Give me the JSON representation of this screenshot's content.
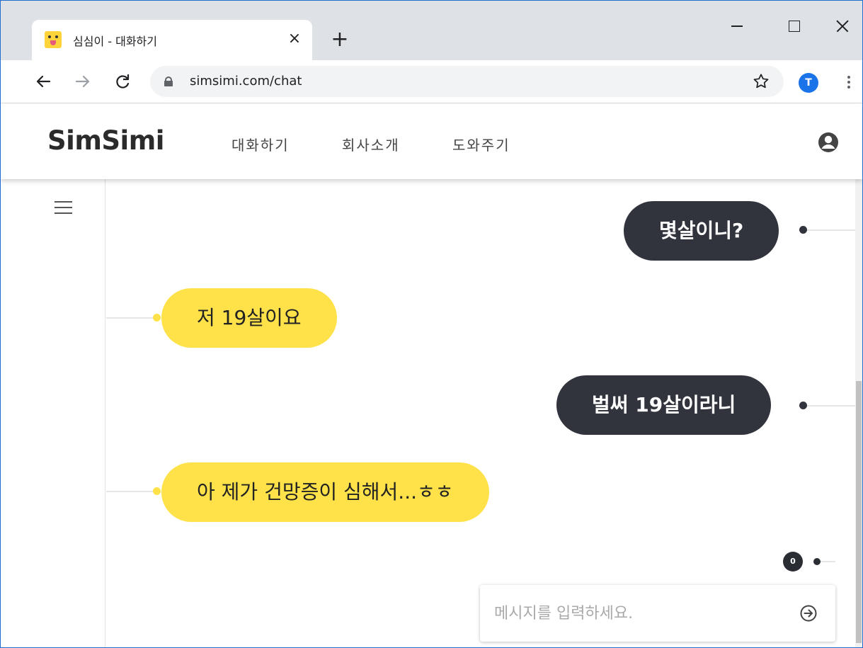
{
  "browser": {
    "tab_title": "심심이 - 대화하기",
    "tab_close": "×",
    "new_tab": "+",
    "url": "simsimi.com/chat",
    "profile_initial": "T",
    "frame_color": "#1e6fd0"
  },
  "header": {
    "logo": "SimSimi",
    "nav": [
      "대화하기",
      "회사소개",
      "도와주기"
    ]
  },
  "chat": {
    "messages": [
      {
        "sender": "user",
        "text": "몇살이니?"
      },
      {
        "sender": "bot",
        "text": "저 19살이요"
      },
      {
        "sender": "user",
        "text": "벌써 19살이라니"
      },
      {
        "sender": "bot",
        "text": "아 제가 건망증이 심해서...ㅎㅎ"
      }
    ],
    "counter": "0",
    "input_placeholder": "메시지를 입력하세요."
  },
  "colors": {
    "bot_bubble": "#ffe24a",
    "user_bubble": "#32343d",
    "profile_avatar": "#1a73e8"
  }
}
